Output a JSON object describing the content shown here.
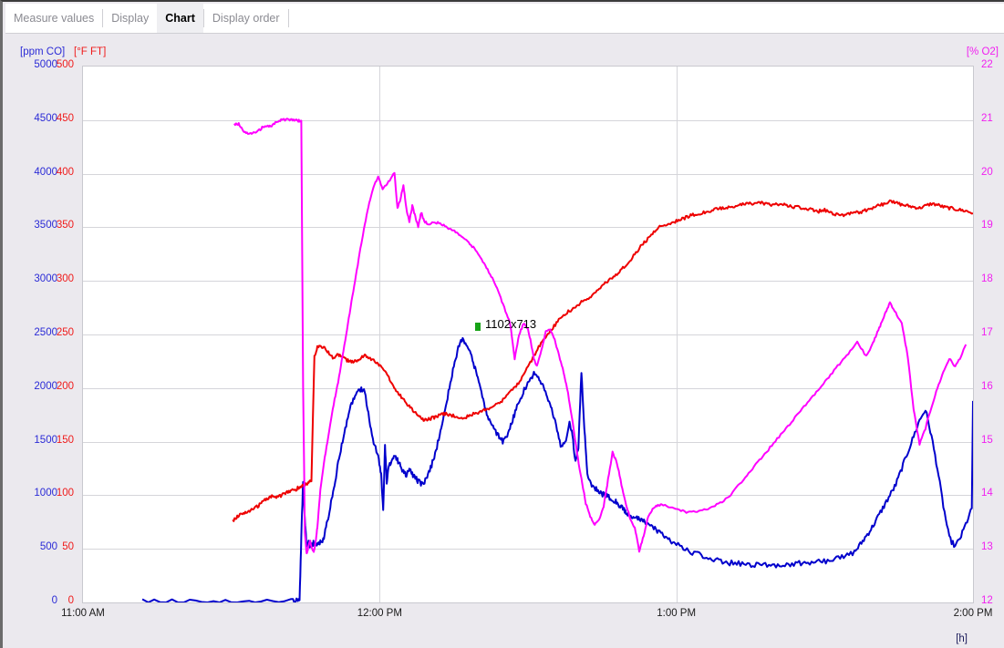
{
  "tabs": [
    {
      "label": "Measure values",
      "active": false
    },
    {
      "label": "Display",
      "active": false
    },
    {
      "label": "Chart",
      "active": true
    },
    {
      "label": "Display order",
      "active": false
    }
  ],
  "axis_titles": {
    "left_primary": "[ppm CO]",
    "left_secondary": "[°F FT]",
    "right": "[% O2]",
    "bottom": "[h]"
  },
  "annotation": {
    "text": "1102x713",
    "marker_color": "#17a317"
  },
  "colors": {
    "co": "#0000cc",
    "ft": "#ee0000",
    "o2": "#ff00ff",
    "grid": "#d5d5da",
    "plot_background": "#ffffff",
    "panel_background": "#ebe9ee"
  },
  "chart_data": {
    "type": "line",
    "title": "",
    "xlabel": "[h]",
    "ylabel": "[ppm CO]",
    "grid": true,
    "legend": "none",
    "x_ticks": [
      "11:00 AM",
      "12:00 PM",
      "1:00 PM",
      "2:00 PM"
    ],
    "x_tick_hours": [
      11,
      12,
      13,
      14
    ],
    "xlim_hours": [
      11,
      14
    ],
    "axes": [
      {
        "name": "CO",
        "unit": "ppm",
        "color": "#0000cc",
        "lim": [
          0,
          5000
        ],
        "ticks": [
          0,
          500,
          1000,
          1500,
          2000,
          2500,
          3000,
          3500,
          4000,
          4500,
          5000
        ],
        "side": "left"
      },
      {
        "name": "FT",
        "unit": "°F",
        "color": "#ee0000",
        "lim": [
          0,
          500
        ],
        "ticks": [
          0,
          50,
          100,
          150,
          200,
          250,
          300,
          350,
          400,
          450,
          500
        ],
        "side": "left"
      },
      {
        "name": "O2",
        "unit": "%",
        "color": "#ff00ff",
        "lim": [
          12,
          22
        ],
        "ticks": [
          12,
          13,
          14,
          15,
          16,
          17,
          18,
          19,
          20,
          21,
          22
        ],
        "side": "right"
      }
    ],
    "series": [
      {
        "name": "O2",
        "unit": "%",
        "color": "#ff00ff",
        "axis": "O2",
        "x": [
          11.51,
          11.525,
          11.54,
          11.556,
          11.572,
          11.588,
          11.604,
          11.62,
          11.636,
          11.652,
          11.668,
          11.684,
          11.7,
          11.716,
          11.724,
          11.73,
          11.736,
          11.742,
          11.748,
          11.754,
          11.76,
          11.766,
          11.772,
          11.778,
          11.784,
          11.79,
          11.8,
          11.815,
          11.83,
          11.845,
          11.86,
          11.875,
          11.89,
          11.905,
          11.92,
          11.935,
          11.95,
          11.965,
          11.98,
          11.995,
          12.01,
          12.03,
          12.05,
          12.06,
          12.07,
          12.08,
          12.09,
          12.1,
          12.11,
          12.12,
          12.13,
          12.14,
          12.15,
          12.165,
          12.18,
          12.2,
          12.22,
          12.24,
          12.26,
          12.28,
          12.3,
          12.32,
          12.34,
          12.36,
          12.38,
          12.4,
          12.42,
          12.44,
          12.455,
          12.47,
          12.485,
          12.5,
          12.51,
          12.52,
          12.53,
          12.545,
          12.56,
          12.575,
          12.59,
          12.605,
          12.62,
          12.635,
          12.65,
          12.665,
          12.68,
          12.695,
          12.71,
          12.725,
          12.74,
          12.755,
          12.77,
          12.785,
          12.8,
          12.815,
          12.83,
          12.845,
          12.86,
          12.875,
          12.89,
          12.905,
          12.92,
          12.935,
          12.95,
          12.98,
          13.01,
          13.04,
          13.07,
          13.1,
          13.13,
          13.16,
          13.19,
          13.22,
          13.25,
          13.28,
          13.31,
          13.34,
          13.37,
          13.4,
          13.43,
          13.46,
          13.49,
          13.52,
          13.55,
          13.58,
          13.61,
          13.64,
          13.66,
          13.675,
          13.69,
          13.705,
          13.72,
          13.74,
          13.76,
          13.78,
          13.8,
          13.82,
          13.84,
          13.86,
          13.88,
          13.9,
          13.92,
          13.94,
          13.96,
          13.98,
          14.0
        ],
        "y": [
          20.92,
          20.93,
          20.8,
          20.75,
          20.76,
          20.78,
          20.86,
          20.88,
          20.89,
          20.96,
          21.0,
          21.01,
          21.0,
          21.0,
          20.99,
          20.99,
          20.99,
          16.0,
          13.3,
          12.9,
          13.05,
          13.15,
          13.0,
          12.95,
          13.12,
          13.4,
          14.1,
          14.7,
          15.2,
          15.7,
          16.1,
          16.6,
          17.1,
          17.6,
          18.1,
          18.6,
          19.05,
          19.45,
          19.75,
          19.95,
          19.72,
          19.85,
          20.02,
          19.35,
          19.52,
          19.78,
          19.35,
          19.1,
          19.4,
          19.2,
          19.0,
          19.28,
          19.12,
          19.05,
          19.1,
          19.08,
          19.02,
          18.96,
          18.9,
          18.82,
          18.72,
          18.6,
          18.42,
          18.25,
          18.05,
          17.8,
          17.5,
          17.2,
          16.55,
          17.0,
          17.2,
          17.1,
          16.85,
          16.55,
          16.4,
          16.7,
          17.05,
          17.1,
          16.9,
          16.6,
          16.3,
          15.9,
          15.4,
          14.8,
          14.3,
          13.85,
          13.6,
          13.45,
          13.55,
          13.8,
          14.3,
          14.8,
          14.6,
          14.2,
          13.85,
          13.55,
          13.4,
          12.95,
          13.25,
          13.6,
          13.75,
          13.8,
          13.82,
          13.78,
          13.72,
          13.68,
          13.7,
          13.74,
          13.8,
          13.9,
          14.05,
          14.25,
          14.45,
          14.65,
          14.85,
          15.05,
          15.25,
          15.45,
          15.65,
          15.85,
          16.05,
          16.25,
          16.45,
          16.65,
          16.85,
          16.6,
          16.8,
          17.0,
          17.2,
          17.4,
          17.6,
          17.4,
          17.2,
          16.6,
          15.6,
          14.95,
          15.25,
          15.65,
          16.0,
          16.3,
          16.55,
          16.4,
          16.6,
          16.85
        ]
      },
      {
        "name": "FT",
        "unit": "°F",
        "color": "#ee0000",
        "axis": "FT",
        "x": [
          11.505,
          11.52,
          11.535,
          11.55,
          11.565,
          11.58,
          11.595,
          11.61,
          11.625,
          11.64,
          11.655,
          11.67,
          11.685,
          11.7,
          11.715,
          11.73,
          11.74,
          11.75,
          11.76,
          11.77,
          11.78,
          11.79,
          11.8,
          11.815,
          11.83,
          11.845,
          11.86,
          11.875,
          11.89,
          11.905,
          11.92,
          11.935,
          11.95,
          11.965,
          11.98,
          11.995,
          12.01,
          12.025,
          12.04,
          12.055,
          12.07,
          12.085,
          12.1,
          12.115,
          12.13,
          12.145,
          12.16,
          12.175,
          12.19,
          12.205,
          12.22,
          12.24,
          12.26,
          12.28,
          12.3,
          12.32,
          12.34,
          12.36,
          12.38,
          12.4,
          12.42,
          12.44,
          12.46,
          12.48,
          12.5,
          12.52,
          12.54,
          12.56,
          12.58,
          12.6,
          12.62,
          12.64,
          12.66,
          12.68,
          12.7,
          12.72,
          12.74,
          12.76,
          12.78,
          12.8,
          12.82,
          12.84,
          12.86,
          12.88,
          12.9,
          12.92,
          12.94,
          12.96,
          12.98,
          13.0,
          13.02,
          13.04,
          13.06,
          13.08,
          13.1,
          13.12,
          13.14,
          13.16,
          13.18,
          13.2,
          13.22,
          13.24,
          13.26,
          13.28,
          13.3,
          13.32,
          13.34,
          13.36,
          13.38,
          13.4,
          13.42,
          13.44,
          13.46,
          13.48,
          13.5,
          13.52,
          13.54,
          13.56,
          13.58,
          13.6,
          13.62,
          13.64,
          13.66,
          13.68,
          13.7,
          13.72,
          13.74,
          13.76,
          13.78,
          13.8,
          13.82,
          13.84,
          13.86,
          13.88,
          13.9,
          13.92,
          13.94,
          13.96,
          13.98,
          14.0
        ],
        "y": [
          76,
          80,
          83,
          84,
          86,
          88,
          91,
          95,
          97,
          99,
          98,
          100,
          102,
          104,
          105,
          108,
          109,
          110,
          112,
          113,
          230,
          238,
          240,
          237,
          232,
          228,
          231,
          229,
          226,
          224,
          225,
          228,
          230,
          228,
          226,
          222,
          218,
          212,
          205,
          198,
          193,
          188,
          183,
          178,
          174,
          171,
          170,
          172,
          173,
          175,
          176,
          175,
          173,
          172,
          174,
          176,
          178,
          180,
          183,
          186,
          190,
          196,
          202,
          210,
          220,
          230,
          240,
          248,
          255,
          262,
          268,
          272,
          276,
          280,
          283,
          287,
          293,
          298,
          302,
          306,
          312,
          318,
          325,
          332,
          338,
          344,
          350,
          352,
          354,
          356,
          358,
          360,
          362,
          363,
          364,
          366,
          367,
          368,
          369,
          370,
          371,
          372,
          372,
          373,
          372,
          371,
          372,
          371,
          370,
          369,
          368,
          367,
          366,
          365,
          366,
          364,
          362,
          361,
          363,
          365,
          364,
          366,
          368,
          370,
          372,
          374,
          373,
          371,
          370,
          369,
          368,
          370,
          372,
          371,
          369,
          368,
          367,
          366,
          365,
          363
        ]
      },
      {
        "name": "CO",
        "unit": "ppm",
        "color": "#0000cc",
        "axis": "CO",
        "x": [
          11.2,
          11.3,
          11.4,
          11.5,
          11.6,
          11.7,
          11.72,
          11.73,
          11.736,
          11.742,
          11.748,
          11.754,
          11.76,
          11.766,
          11.772,
          11.78,
          11.79,
          11.8,
          11.812,
          11.824,
          11.836,
          11.848,
          11.86,
          11.875,
          11.89,
          11.905,
          11.92,
          11.935,
          11.95,
          11.965,
          11.98,
          11.995,
          12.005,
          12.012,
          12.018,
          12.024,
          12.03,
          12.04,
          12.05,
          12.06,
          12.07,
          12.08,
          12.09,
          12.1,
          12.11,
          12.12,
          12.13,
          12.145,
          12.16,
          12.175,
          12.19,
          12.205,
          12.22,
          12.235,
          12.25,
          12.265,
          12.28,
          12.295,
          12.31,
          12.325,
          12.34,
          12.355,
          12.37,
          12.385,
          12.4,
          12.415,
          12.43,
          12.445,
          12.46,
          12.475,
          12.49,
          12.505,
          12.52,
          12.535,
          12.55,
          12.565,
          12.58,
          12.595,
          12.61,
          12.625,
          12.64,
          12.65,
          12.66,
          12.67,
          12.68,
          12.69,
          12.7,
          12.715,
          12.73,
          12.745,
          12.76,
          12.775,
          12.79,
          12.8,
          12.81,
          12.82,
          12.83,
          12.84,
          12.855,
          12.87,
          12.885,
          12.9,
          12.92,
          12.94,
          12.96,
          12.98,
          13.0,
          13.03,
          13.06,
          13.09,
          13.12,
          13.15,
          13.18,
          13.21,
          13.24,
          13.27,
          13.3,
          13.33,
          13.36,
          13.39,
          13.42,
          13.45,
          13.48,
          13.51,
          13.54,
          13.57,
          13.6,
          13.62,
          13.64,
          13.66,
          13.68,
          13.7,
          13.72,
          13.74,
          13.76,
          13.78,
          13.8,
          13.82,
          13.84,
          13.86,
          13.88,
          13.9,
          13.92,
          13.94,
          13.96,
          13.98,
          14.0
        ],
        "y": [
          10,
          10,
          10,
          10,
          10,
          10,
          12,
          14,
          620,
          1120,
          760,
          520,
          560,
          520,
          545,
          560,
          540,
          560,
          600,
          760,
          930,
          1100,
          1300,
          1500,
          1700,
          1850,
          1940,
          1990,
          1960,
          1700,
          1500,
          1350,
          1200,
          850,
          1460,
          1100,
          1250,
          1320,
          1380,
          1330,
          1280,
          1220,
          1180,
          1240,
          1200,
          1160,
          1130,
          1100,
          1160,
          1280,
          1420,
          1600,
          1800,
          2000,
          2200,
          2380,
          2460,
          2400,
          2300,
          2150,
          1980,
          1820,
          1700,
          1620,
          1560,
          1500,
          1560,
          1680,
          1800,
          1900,
          2000,
          2080,
          2130,
          2100,
          2020,
          1920,
          1800,
          1650,
          1460,
          1480,
          1700,
          1560,
          1300,
          1460,
          2150,
          1620,
          1200,
          1100,
          1060,
          1020,
          1000,
          980,
          950,
          930,
          900,
          870,
          840,
          820,
          800,
          780,
          760,
          740,
          700,
          660,
          620,
          580,
          540,
          500,
          460,
          430,
          400,
          380,
          370,
          362,
          358,
          352,
          350,
          350,
          354,
          360,
          366,
          372,
          378,
          390,
          410,
          430,
          470,
          540,
          620,
          700,
          800,
          900,
          1000,
          1100,
          1250,
          1400,
          1550,
          1700,
          1800,
          1550,
          1250,
          900,
          600,
          520,
          620,
          760,
          900,
          1050,
          1250,
          1450,
          1650,
          1880
        ]
      }
    ]
  }
}
